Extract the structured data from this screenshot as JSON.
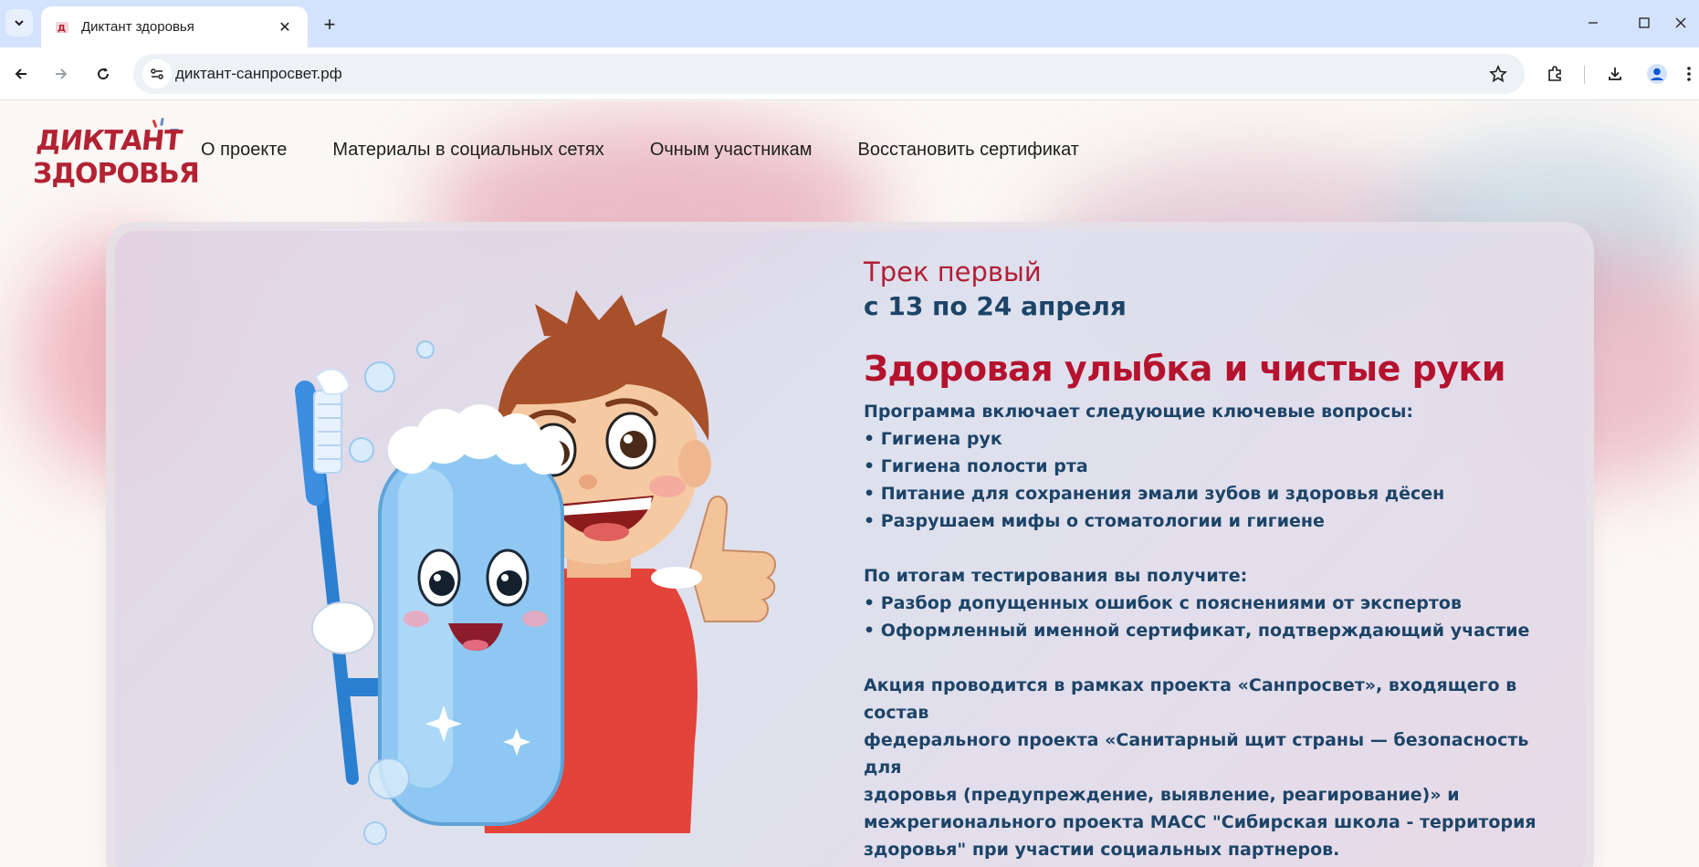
{
  "browser": {
    "tab_title": "Диктант здоровья",
    "url": "диктант-санпросвет.рф",
    "new_tab_symbol": "+",
    "close_symbol": "✕"
  },
  "site": {
    "logo_line1": "ДИКТАНТ",
    "logo_line2": "ЗДОРОВЬЯ",
    "nav": [
      {
        "label": "О проекте"
      },
      {
        "label": "Материалы в социальных сетях"
      },
      {
        "label": "Очным участникам"
      },
      {
        "label": "Восстановить сертификат"
      }
    ]
  },
  "card": {
    "track_label": "Трек первый",
    "track_dates": "с 13 по 24 апреля",
    "title": "Здоровая улыбка и чистые руки",
    "program_heading": "Программа включает следующие ключевые вопросы:",
    "program_items": [
      "• Гигиена рук",
      "• Гигиена полости рта",
      "• Питание для сохранения эмали зубов и здоровья дёсен",
      "• Разрушаем мифы о стоматологии и гигиене"
    ],
    "results_heading": "По итогам тестирования вы получите:",
    "results_items": [
      "• Разбор допущенных ошибок с пояснениями от экспертов",
      "• Оформленный именной сертификат, подтверждающий участие"
    ],
    "footer_lines": [
      "Акция проводится в рамках проекта «Санпросвет», входящего в состав",
      "федерального проекта «Санитарный щит страны — безопасность для",
      "здоровья (предупреждение, выявление, реагирование)» и",
      "межрегионального проекта МАСС \"Сибирская школа - территория",
      "здоровья\" при участии социальных партнеров."
    ]
  },
  "colors": {
    "accent_red": "#b5122e",
    "text_blue": "#1c4468",
    "chrome_tabbar": "#d3e3fd"
  },
  "icons": [
    "tab-search-icon",
    "favicon",
    "close-icon",
    "plus-icon",
    "minimize-icon",
    "maximize-icon",
    "back-icon",
    "forward-icon",
    "reload-icon",
    "site-info-icon",
    "star-icon",
    "extensions-icon",
    "download-icon",
    "profile-icon",
    "menu-icon"
  ]
}
